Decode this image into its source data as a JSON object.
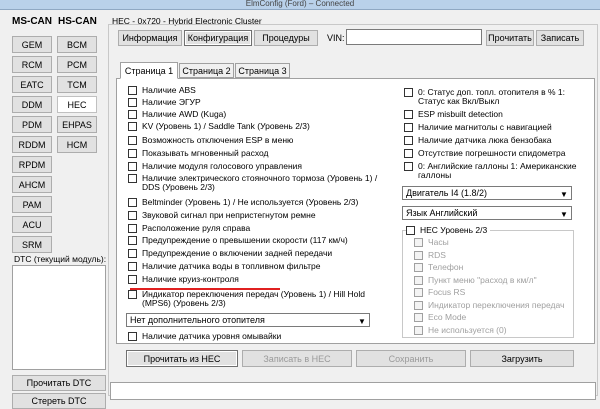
{
  "window": {
    "title": "ElmConfig (Ford) – Connected"
  },
  "left": {
    "ms_can_label": "MS-CAN",
    "hs_can_label": "HS-CAN",
    "ms_modules": [
      "GEM",
      "RCM",
      "EATC",
      "DDM",
      "PDM",
      "RDDM",
      "RPDM",
      "AHCM",
      "PAM",
      "ACU",
      "SRM"
    ],
    "hs_modules": [
      "BCM",
      "PCM",
      "TCM",
      "HEC",
      "EHPAS",
      "HCM"
    ],
    "dtc_label": "DTC (текущий модуль):",
    "read_dtc": "Прочитать DTC",
    "clear_dtc": "Стереть DTC"
  },
  "module": {
    "header": "HEC - 0x720 - Hybrid Electronic Cluster",
    "tabs": [
      "Информация",
      "Конфигурация",
      "Процедуры"
    ],
    "vin_label": "VIN:",
    "vin_value": "",
    "read_btn": "Прочитать",
    "write_btn": "Записать"
  },
  "pages": [
    "Страница 1",
    "Страница 2",
    "Страница 3"
  ],
  "left_options": [
    "Наличие ABS",
    "Наличие ЭГУР",
    "Наличие AWD (Kuga)",
    "KV (Уровень 1) / Saddle Tank (Уровень 2/3)",
    "Возможность отключения ESP в меню",
    "Показывать мгновенный расход",
    "Наличие модуля голосового управления",
    "Наличие электрического стояночного тормоза (Уровень 1) / DDS (Уровень 2/3)",
    "Beltminder (Уровень 1) / Не используется (Уровень 2/3)",
    "Звуковой сигнал при непристегнутом ремне",
    "Расположение руля справа",
    "Предупреждение о превышении скорости (117 км/ч)",
    "Предупреждение о включении задней передачи",
    "Наличие датчика воды в топливном фильтре",
    "Наличие круиз-контроля",
    "Индикатор переключения передач (Уровень 1) / Hill Hold (MPS6) (Уровень 2/3)"
  ],
  "heater_combo": "Нет дополнительного отопителя",
  "washer_option": "Наличие датчика уровня омывайки",
  "right_options": [
    "0: Статус доп. топл. отопителя в % 1: Статус как Вкл/Выкл",
    "ESP misbuilt detection",
    "Наличие магнитолы с навигацией",
    "Наличие датчика люка бензобака",
    "Отсутствие погрешности спидометра",
    "0: Английские галлоны 1: Американские галлоны"
  ],
  "engine_combo": "Двигатель I4 (1.8/2)",
  "language_combo": "Язык Английский",
  "hec_group": {
    "title": "HEC Уровень 2/3",
    "items": [
      "Часы",
      "RDS",
      "Телефон",
      "Пункт меню \"расход в км/л\"",
      "Focus RS",
      "Индикатор переключения передач",
      "Eco Mode",
      "Не используется (0)"
    ]
  },
  "bottom": {
    "read_hec": "Прочитать из HEC",
    "write_hec": "Записать в HEC",
    "save": "Сохранить",
    "load": "Загрузить"
  },
  "colors": {
    "highlight_underline": "#e02020",
    "accent_border": "#3399ff"
  }
}
